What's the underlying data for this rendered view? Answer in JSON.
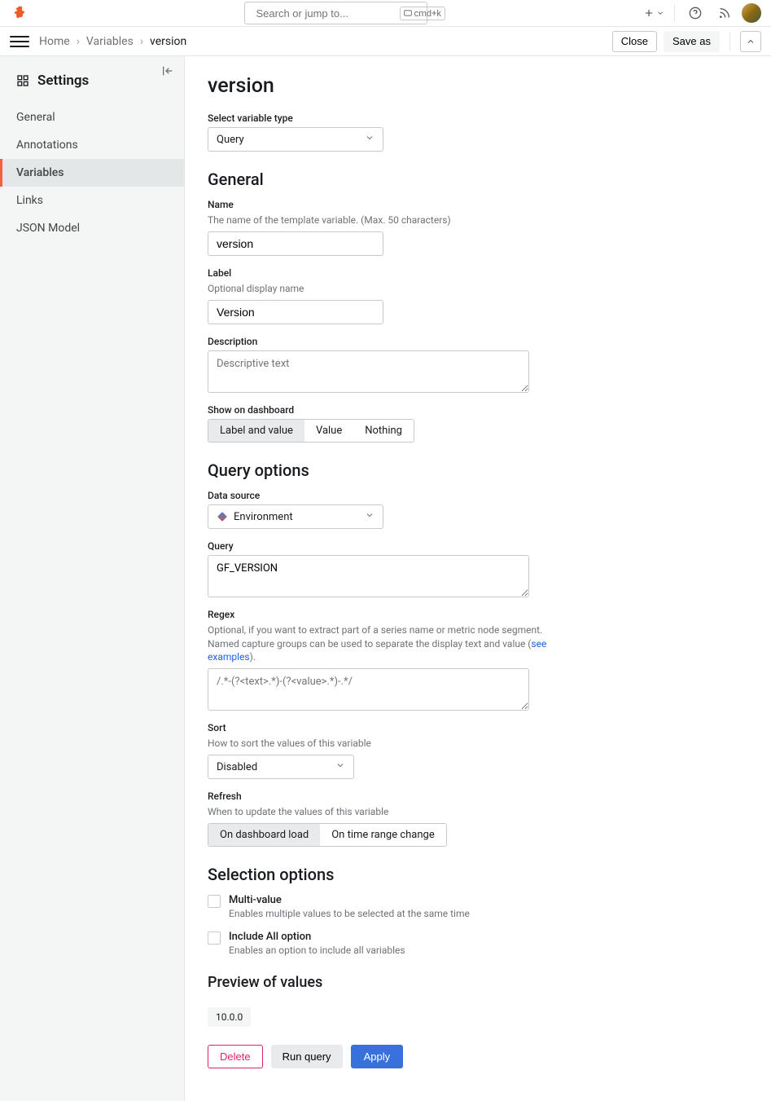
{
  "header": {
    "search_placeholder": "Search or jump to...",
    "shortcut": "cmd+k"
  },
  "breadcrumb": {
    "items": [
      "Home",
      "Variables",
      "version"
    ]
  },
  "subheader_buttons": {
    "close": "Close",
    "save_as": "Save as"
  },
  "sidebar": {
    "title": "Settings",
    "items": [
      "General",
      "Annotations",
      "Variables",
      "Links",
      "JSON Model"
    ],
    "active_index": 2
  },
  "page": {
    "title": "version",
    "select_type_label": "Select variable type",
    "select_type_value": "Query",
    "general_title": "General",
    "name_label": "Name",
    "name_help": "The name of the template variable. (Max. 50 characters)",
    "name_value": "version",
    "label_label": "Label",
    "label_help": "Optional display name",
    "label_value": "Version",
    "description_label": "Description",
    "description_placeholder": "Descriptive text",
    "description_value": "",
    "show_label": "Show on dashboard",
    "show_options": [
      "Label and value",
      "Value",
      "Nothing"
    ],
    "show_active": 0,
    "query_options_title": "Query options",
    "datasource_label": "Data source",
    "datasource_value": "Environment",
    "query_label": "Query",
    "query_value": "GF_VERSION",
    "regex_label": "Regex",
    "regex_help_1": "Optional, if you want to extract part of a series name or metric node segment. Named capture groups can be used to separate the display text and value (",
    "regex_help_link": "see examples",
    "regex_help_2": ").",
    "regex_placeholder": "/.*-(?<text>.*)-(?<value>.*)-.*/",
    "regex_value": "",
    "sort_label": "Sort",
    "sort_help": "How to sort the values of this variable",
    "sort_value": "Disabled",
    "refresh_label": "Refresh",
    "refresh_help": "When to update the values of this variable",
    "refresh_options": [
      "On dashboard load",
      "On time range change"
    ],
    "refresh_active": 0,
    "selection_title": "Selection options",
    "multi_label": "Multi-value",
    "multi_help": "Enables multiple values to be selected at the same time",
    "include_all_label": "Include All option",
    "include_all_help": "Enables an option to include all variables",
    "preview_title": "Preview of values",
    "preview_value": "10.0.0",
    "delete_btn": "Delete",
    "run_query_btn": "Run query",
    "apply_btn": "Apply"
  }
}
